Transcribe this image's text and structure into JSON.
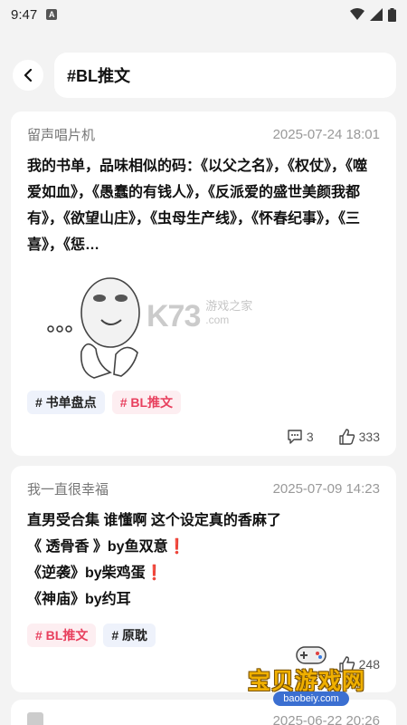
{
  "status_bar": {
    "time": "9:47",
    "app_badge": "A"
  },
  "search": {
    "query": "#BL推文"
  },
  "posts": [
    {
      "author": "留声唱片机",
      "time": "2025-07-24 18:01",
      "content": "我的书单，品味相似的码：《以父之名》，《权仗》，《噬爱如血》，《愚蠢的有钱人》，《反派爱的盛世美颜我都有》，《欲望山庄》，《虫母生产线》，《怀春纪事》，《三喜》，《惩…",
      "tags": [
        "# 书单盘点",
        "# BL推文"
      ],
      "comments": "3",
      "likes": "333"
    },
    {
      "author": "我一直很幸福",
      "time": "2025-07-09 14:23",
      "lines": [
        "直男受合集 谁懂啊 这个设定真的香麻了",
        "《 透骨香 》by鱼双意",
        "《逆袭》by柴鸡蛋",
        "《神庙》by约耳"
      ],
      "exclaim": "❗",
      "tags": [
        "# BL推文",
        "# 原耽"
      ],
      "likes": "248"
    },
    {
      "time": "2025-06-22 20:26"
    }
  ],
  "watermarks": {
    "k73": "K73",
    "k73_sub": "游戏之家",
    "k73_url": ".com",
    "baobei": "宝贝游戏网",
    "baobei_url": "baobeiy.com"
  }
}
